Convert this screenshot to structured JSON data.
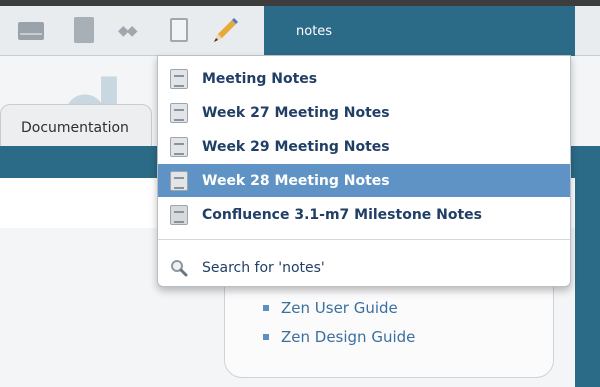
{
  "search": {
    "value": "notes"
  },
  "background": {
    "tab_label": "Documentation",
    "guide_links": [
      "Zen User Guide",
      "Zen Design Guide"
    ]
  },
  "dropdown": {
    "items": [
      {
        "label": "Meeting Notes",
        "icon": "page-icon",
        "selected": false
      },
      {
        "label": "Week 27 Meeting Notes",
        "icon": "page-icon",
        "selected": false
      },
      {
        "label": "Week 29 Meeting Notes",
        "icon": "page-icon",
        "selected": false
      },
      {
        "label": "Week 28 Meeting Notes",
        "icon": "page-icon",
        "selected": true
      },
      {
        "label": "Confluence 3.1-m7 Milestone Notes",
        "icon": "milestone-page-icon",
        "selected": false
      }
    ],
    "search_for": "Search for 'notes'"
  },
  "colors": {
    "header_blue": "#2c6b87",
    "selection_blue": "#5f93c5",
    "link_blue": "#3a6f9f",
    "item_text": "#213f66"
  }
}
